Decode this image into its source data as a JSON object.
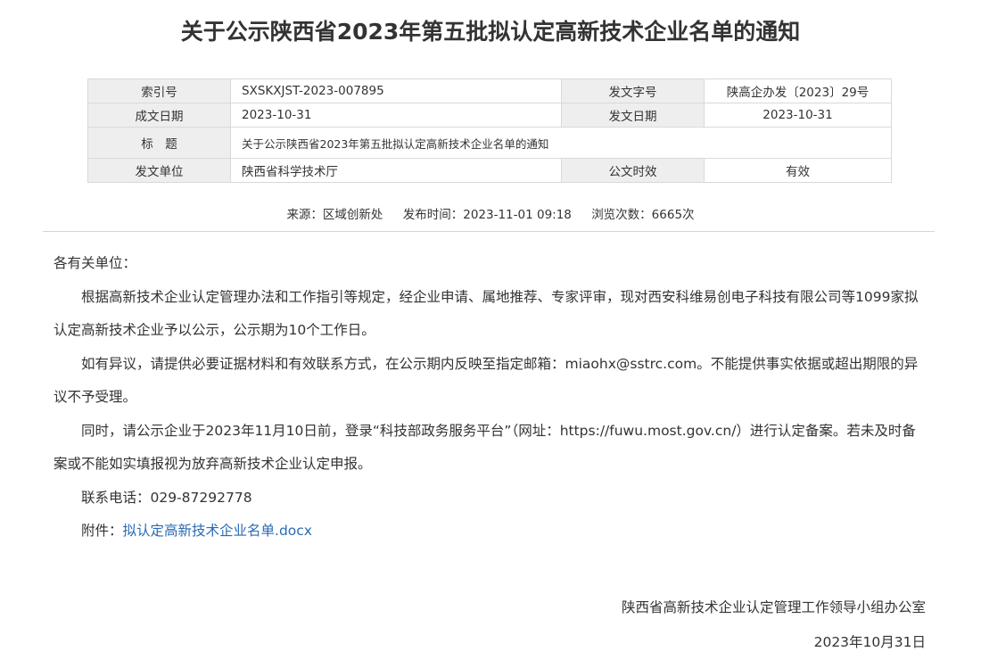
{
  "title": "关于公示陕西省2023年第五批拟认定高新技术企业名单的通知",
  "meta_table": {
    "index_label": "索引号",
    "index_value": "SXSKXJST-2023-007895",
    "docno_label": "发文字号",
    "docno_value": "陕高企办发〔2023〕29号",
    "date_label": "成文日期",
    "date_value": "2023-10-31",
    "issue_date_label": "发文日期",
    "issue_date_value": "2023-10-31",
    "subject_label": "标　题",
    "subject_value": "关于公示陕西省2023年第五批拟认定高新技术企业名单的通知",
    "unit_label": "发文单位",
    "unit_value": "陕西省科学技术厅",
    "validity_label": "公文时效",
    "validity_value": "有效"
  },
  "meta_line": {
    "source": "来源：区域创新处",
    "published": "发布时间：2023-11-01 09:18",
    "views": "浏览次数：6665次"
  },
  "body": {
    "salutation": "各有关单位：",
    "para1": "根据高新技术企业认定管理办法和工作指引等规定，经企业申请、属地推荐、专家评审，现对西安科维易创电子科技有限公司等1099家拟认定高新技术企业予以公示，公示期为10个工作日。",
    "para2": "如有异议，请提供必要证据材料和有效联系方式，在公示期内反映至指定邮箱：miaohx@sstrc.com。不能提供事实依据或超出期限的异议不予受理。",
    "para3": "同时，请公示企业于2023年11月10日前，登录“科技部政务服务平台”（网址：https://fuwu.most.gov.cn/）进行认定备案。若未及时备案或不能如实填报视为放弃高新技术企业认定申报。",
    "contact": "联系电话：029-87292778",
    "attachment_label": "附件：",
    "attachment_link": "拟认定高新技术企业名单.docx"
  },
  "signature": {
    "org": "陕西省高新技术企业认定管理工作领导小组办公室",
    "date": "2023年10月31日"
  }
}
